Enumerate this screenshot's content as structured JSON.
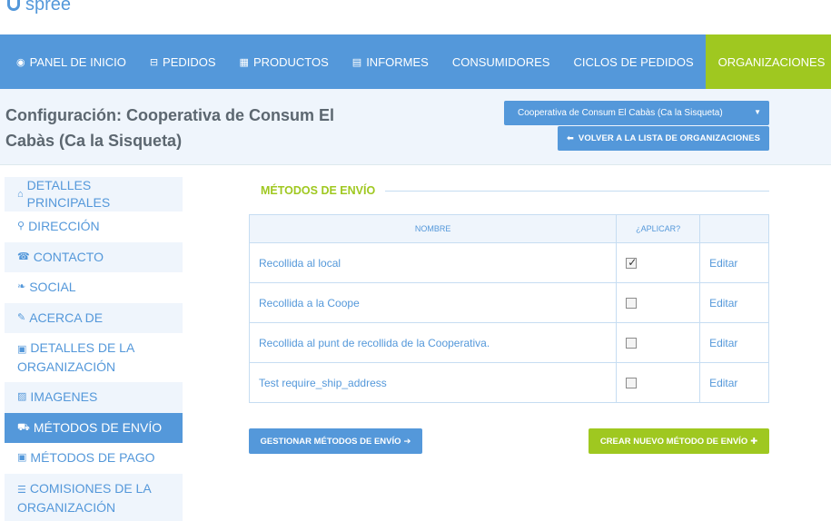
{
  "app": {
    "logo_text": "spree"
  },
  "nav": {
    "items": [
      {
        "label": "PANEL DE INICIO",
        "icon": "dashboard-icon"
      },
      {
        "label": "PEDIDOS",
        "icon": "cart-icon"
      },
      {
        "label": "PRODUCTOS",
        "icon": "th-large-icon"
      },
      {
        "label": "INFORMES",
        "icon": "file-icon"
      },
      {
        "label": "CONSUMIDORES",
        "icon": ""
      },
      {
        "label": "CICLOS DE PEDIDOS",
        "icon": ""
      },
      {
        "label": "ORGANIZACIONES",
        "icon": "",
        "active": true
      }
    ]
  },
  "header": {
    "title": "Configuración: Cooperativa de Consum El Cabàs (Ca la Sisqueta)",
    "org_select_value": "Cooperativa de Consum El Cabàs (Ca la Sisqueta)",
    "back_button_label": "VOLVER A LA LISTA DE ORGANIZACIONES"
  },
  "sidebar": {
    "items": [
      {
        "label": "DETALLES PRINCIPALES",
        "icon": "home-icon"
      },
      {
        "label": "DIRECCIÓN",
        "icon": "map-marker-icon"
      },
      {
        "label": "CONTACTO",
        "icon": "phone-icon"
      },
      {
        "label": "SOCIAL",
        "icon": "twitter-icon"
      },
      {
        "label": "ACERCA DE",
        "icon": "pencil-icon"
      },
      {
        "label": "DETALLES DE LA ORGANIZACIÓN",
        "icon": "briefcase-icon"
      },
      {
        "label": "IMAGENES",
        "icon": "picture-icon"
      },
      {
        "label": "MÉTODOS DE ENVÍO",
        "icon": "truck-icon",
        "active": true
      },
      {
        "label": "MÉTODOS DE PAGO",
        "icon": "money-icon"
      },
      {
        "label": "COMISIONES DE LA ORGANIZACIÓN",
        "icon": "list-icon"
      }
    ]
  },
  "section": {
    "title": "MÉTODOS DE ENVÍO",
    "table": {
      "headers": [
        "NOMBRE",
        "¿APLICAR?",
        ""
      ],
      "rows": [
        {
          "name": "Recollida al local",
          "apply": true,
          "edit": "Editar"
        },
        {
          "name": "Recollida a la Coope",
          "apply": false,
          "edit": "Editar"
        },
        {
          "name": "Recollida al punt de recollida de la Cooperativa.",
          "apply": false,
          "edit": "Editar"
        },
        {
          "name": "Test require_ship_address",
          "apply": false,
          "edit": "Editar"
        }
      ]
    },
    "manage_button_label": "GESTIONAR MÉTODOS DE ENVÍO",
    "create_button_label": "CREAR NUEVO MÉTODO DE ENVÍO"
  },
  "colors": {
    "primary": "#5498da",
    "accent": "#9fc820",
    "tint": "#eff5fc"
  }
}
